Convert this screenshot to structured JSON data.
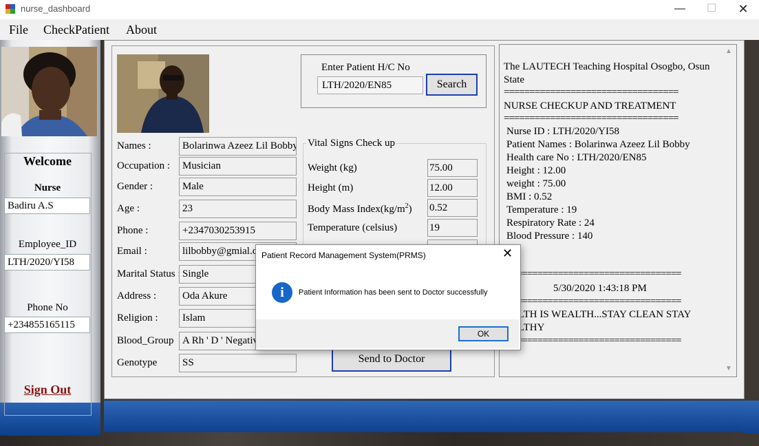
{
  "window": {
    "title": "nurse_dashboard"
  },
  "menu": {
    "items": [
      "File",
      "CheckPatient",
      "About"
    ]
  },
  "sidebar": {
    "welcome": "Welcome",
    "role_label": "Nurse",
    "name": "Badiru A.S",
    "employee_id_label": "Employee_ID",
    "employee_id": "LTH/2020/YI58",
    "phone_label": "Phone No",
    "phone": "+234855165115",
    "sign_out": "Sign Out"
  },
  "search": {
    "label": "Enter Patient H/C No",
    "value": "LTH/2020/EN85",
    "button": "Search"
  },
  "patient": {
    "fields": [
      {
        "label": "Names :",
        "value": "Bolarinwa Azeez Lil Bobby"
      },
      {
        "label": "Occupation :",
        "value": "Musician"
      },
      {
        "label": "Gender :",
        "value": "Male"
      },
      {
        "label": "Age :",
        "value": "23"
      },
      {
        "label": "Phone :",
        "value": "+2347030253915"
      },
      {
        "label": "Email :",
        "value": "lilbobby@gmial.com"
      },
      {
        "label": "Marital Status :",
        "value": "Single"
      },
      {
        "label": "Address :",
        "value": "Oda Akure"
      },
      {
        "label": "Religion :",
        "value": "Islam"
      },
      {
        "label": "Blood_Group",
        "value": "A Rh ' D ' Negative"
      },
      {
        "label": "Genotype",
        "value": "SS"
      }
    ]
  },
  "vitals": {
    "title": "Vital Signs Check up",
    "weight_label": "Weight (kg)",
    "weight": "75.00",
    "height_label": "Height (m)",
    "height": "12.00",
    "bmi_label": "Body Mass Index(kg/m",
    "bmi_sup": "2",
    "bmi_close": ")",
    "bmi": "0.52",
    "temp_label": "Temperature (celsius)",
    "temp": "19"
  },
  "send_button": "Send to Doctor",
  "report": {
    "lines": [
      "The LAUTECH Teaching Hospital Osogbo, Osun",
      "State",
      "==================================",
      "NURSE CHECKUP AND TREATMENT",
      "==================================",
      "Nurse ID : LTH/2020/YI58",
      "Patient Names : Bolarinwa Azeez Lil Bobby",
      "Health care No : LTH/2020/EN85",
      "Height : 12.00",
      "weight : 75.00",
      "BMI : 0.52",
      "Temperature : 19",
      "Respiratory Rate : 24",
      "Blood Pressure : 140",
      "==================================",
      "5/30/2020  1:43:18 PM",
      "==================================",
      "HEALTH IS WEALTH...STAY CLEAN STAY",
      "HEALTHY",
      "=================================="
    ]
  },
  "dialog": {
    "title": "Patient Record Management System(PRMS)",
    "message": "Patient Information has been sent to Doctor successfully",
    "ok": "OK",
    "icon": "info-icon"
  }
}
